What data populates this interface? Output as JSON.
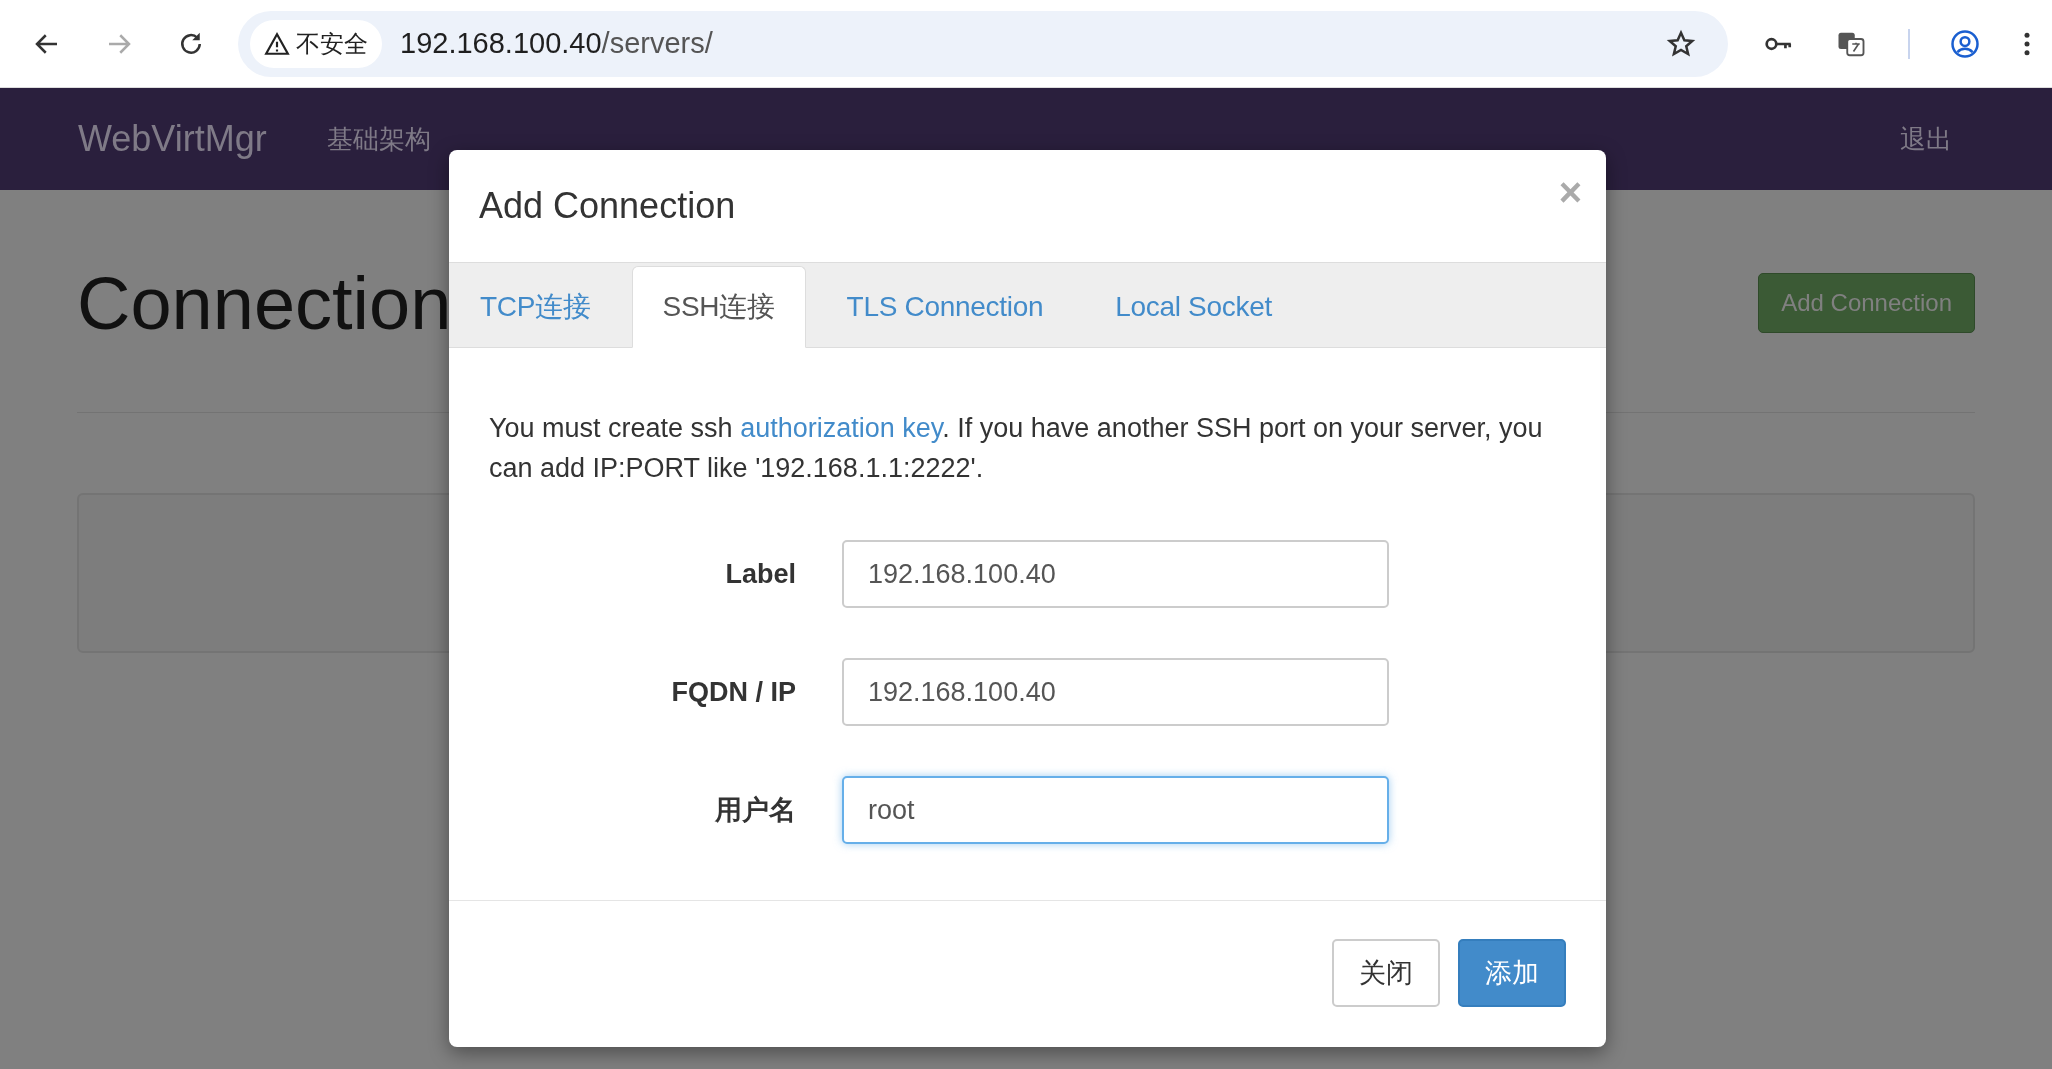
{
  "browser": {
    "security_label": "不安全",
    "url_host": "192.168.100.40",
    "url_path": "/servers/",
    "forward_disabled": true
  },
  "navbar": {
    "brand": "WebVirtMgr",
    "links": [
      "基础架构"
    ],
    "logout": "退出"
  },
  "page": {
    "heading": "Connection",
    "add_button": "Add Connection"
  },
  "modal": {
    "title": "Add Connection",
    "close": "×",
    "tabs": [
      {
        "label": "TCP连接",
        "selected": false
      },
      {
        "label": "SSH连接",
        "selected": true
      },
      {
        "label": "TLS Connection",
        "selected": false
      },
      {
        "label": "Local Socket",
        "selected": false
      }
    ],
    "intro": {
      "before": "You must create ssh ",
      "link": "authorization key",
      "after": ". If you have another SSH port on your server, you can add IP:PORT like '192.168.1.1:2222'."
    },
    "fields": [
      {
        "label": "Label",
        "value": "192.168.100.40",
        "focused": false
      },
      {
        "label": "FQDN / IP",
        "value": "192.168.100.40",
        "focused": false
      },
      {
        "label": "用户名",
        "value": "root",
        "focused": true
      }
    ],
    "buttons": [
      {
        "label": "关闭",
        "kind": "default"
      },
      {
        "label": "添加",
        "kind": "primary"
      }
    ]
  }
}
